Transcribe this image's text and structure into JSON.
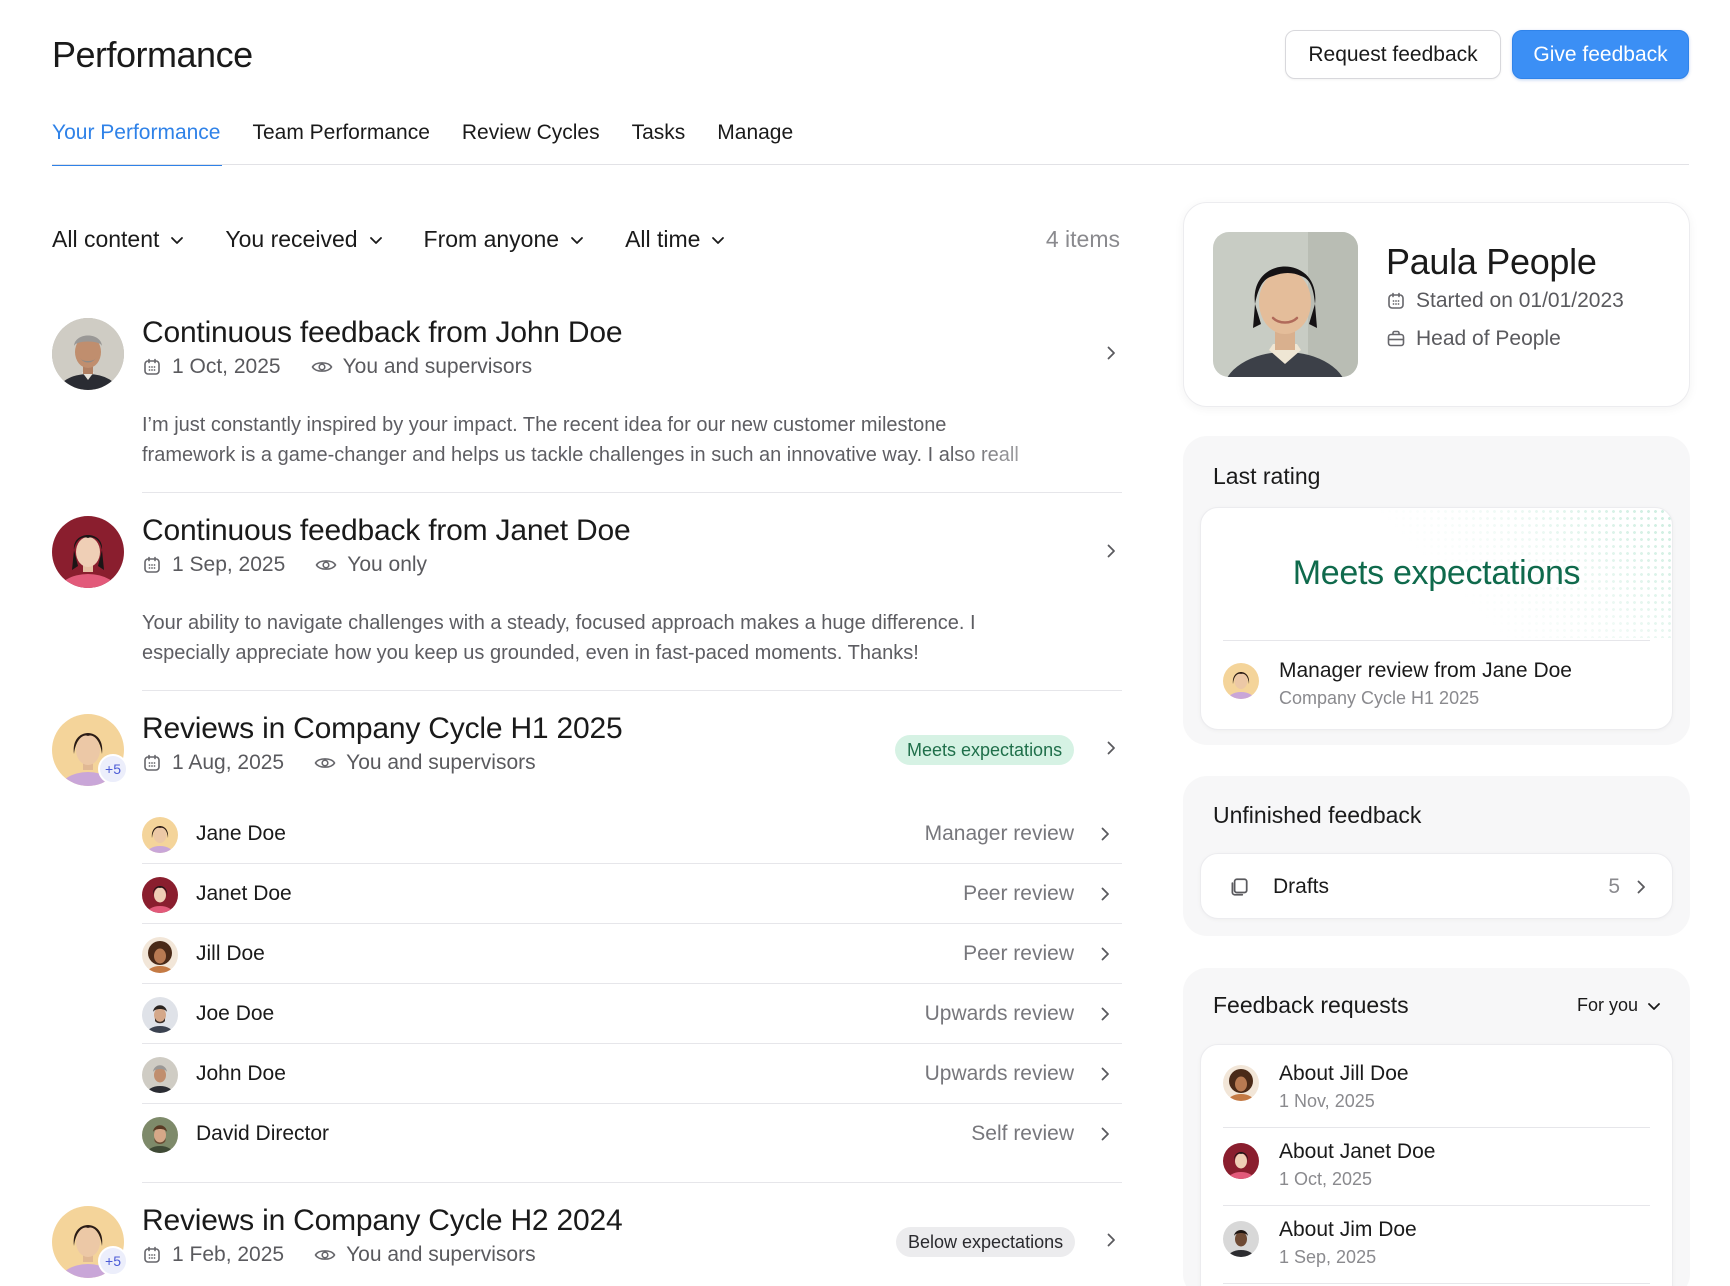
{
  "header": {
    "title": "Performance",
    "request_feedback": "Request feedback",
    "give_feedback": "Give feedback"
  },
  "tabs": [
    "Your Performance",
    "Team Performance",
    "Review Cycles",
    "Tasks",
    "Manage"
  ],
  "active_tab": "Your Performance",
  "filters": {
    "content": "All content",
    "direction": "You received",
    "source": "From anyone",
    "time": "All time",
    "count": "4 items"
  },
  "feed": [
    {
      "title": "Continuous feedback from John Doe",
      "date": "1 Oct, 2025",
      "visibility": "You and supervisors",
      "excerpt_line1": "I’m just constantly inspired by your impact. The recent idea for our new customer milestone",
      "excerpt_line2": "framework is a game-changer and helps us tackle challenges in such an innovative way. I also reall"
    },
    {
      "title": "Continuous feedback from Janet Doe",
      "date": "1 Sep, 2025",
      "visibility": "You only",
      "excerpt_line1": "Your ability to navigate challenges with a steady, focused approach makes a huge difference. I",
      "excerpt_line2": "especially appreciate how you keep us grounded, even in fast-paced moments. Thanks!"
    },
    {
      "title": "Reviews in Company Cycle H1 2025",
      "date": "1 Aug, 2025",
      "visibility": "You and supervisors",
      "badge": "Meets expectations",
      "plus": "+5",
      "reviews": [
        {
          "name": "Jane Doe",
          "type": "Manager review"
        },
        {
          "name": "Janet Doe",
          "type": "Peer review"
        },
        {
          "name": "Jill Doe",
          "type": "Peer review"
        },
        {
          "name": "Joe Doe",
          "type": "Upwards review"
        },
        {
          "name": "John Doe",
          "type": "Upwards review"
        },
        {
          "name": "David Director",
          "type": "Self review"
        }
      ]
    },
    {
      "title": "Reviews in Company Cycle H2 2024",
      "date": "1 Feb, 2025",
      "visibility": "You and supervisors",
      "badge": "Below expectations",
      "plus": "+5"
    }
  ],
  "profile": {
    "name": "Paula People",
    "started": "Started on 01/01/2023",
    "role": "Head of People"
  },
  "last_rating": {
    "title": "Last rating",
    "rating": "Meets expectations",
    "review_title": "Manager review from Jane Doe",
    "review_cycle": "Company Cycle H1 2025"
  },
  "unfinished": {
    "title": "Unfinished feedback",
    "drafts_label": "Drafts",
    "drafts_count": "5"
  },
  "requests": {
    "title": "Feedback requests",
    "filter": "For you",
    "items": [
      {
        "title": "About Jill Doe",
        "date": "1 Nov, 2025"
      },
      {
        "title": "About Janet Doe",
        "date": "1 Oct, 2025"
      },
      {
        "title": "About Jim Doe",
        "date": "1 Sep, 2025"
      }
    ]
  },
  "colors": {
    "accent": "#3b8ff5",
    "rating_green": "#0f6a4c",
    "badge_green_bg": "#d6f2e4",
    "badge_gray_bg": "#ececee"
  }
}
